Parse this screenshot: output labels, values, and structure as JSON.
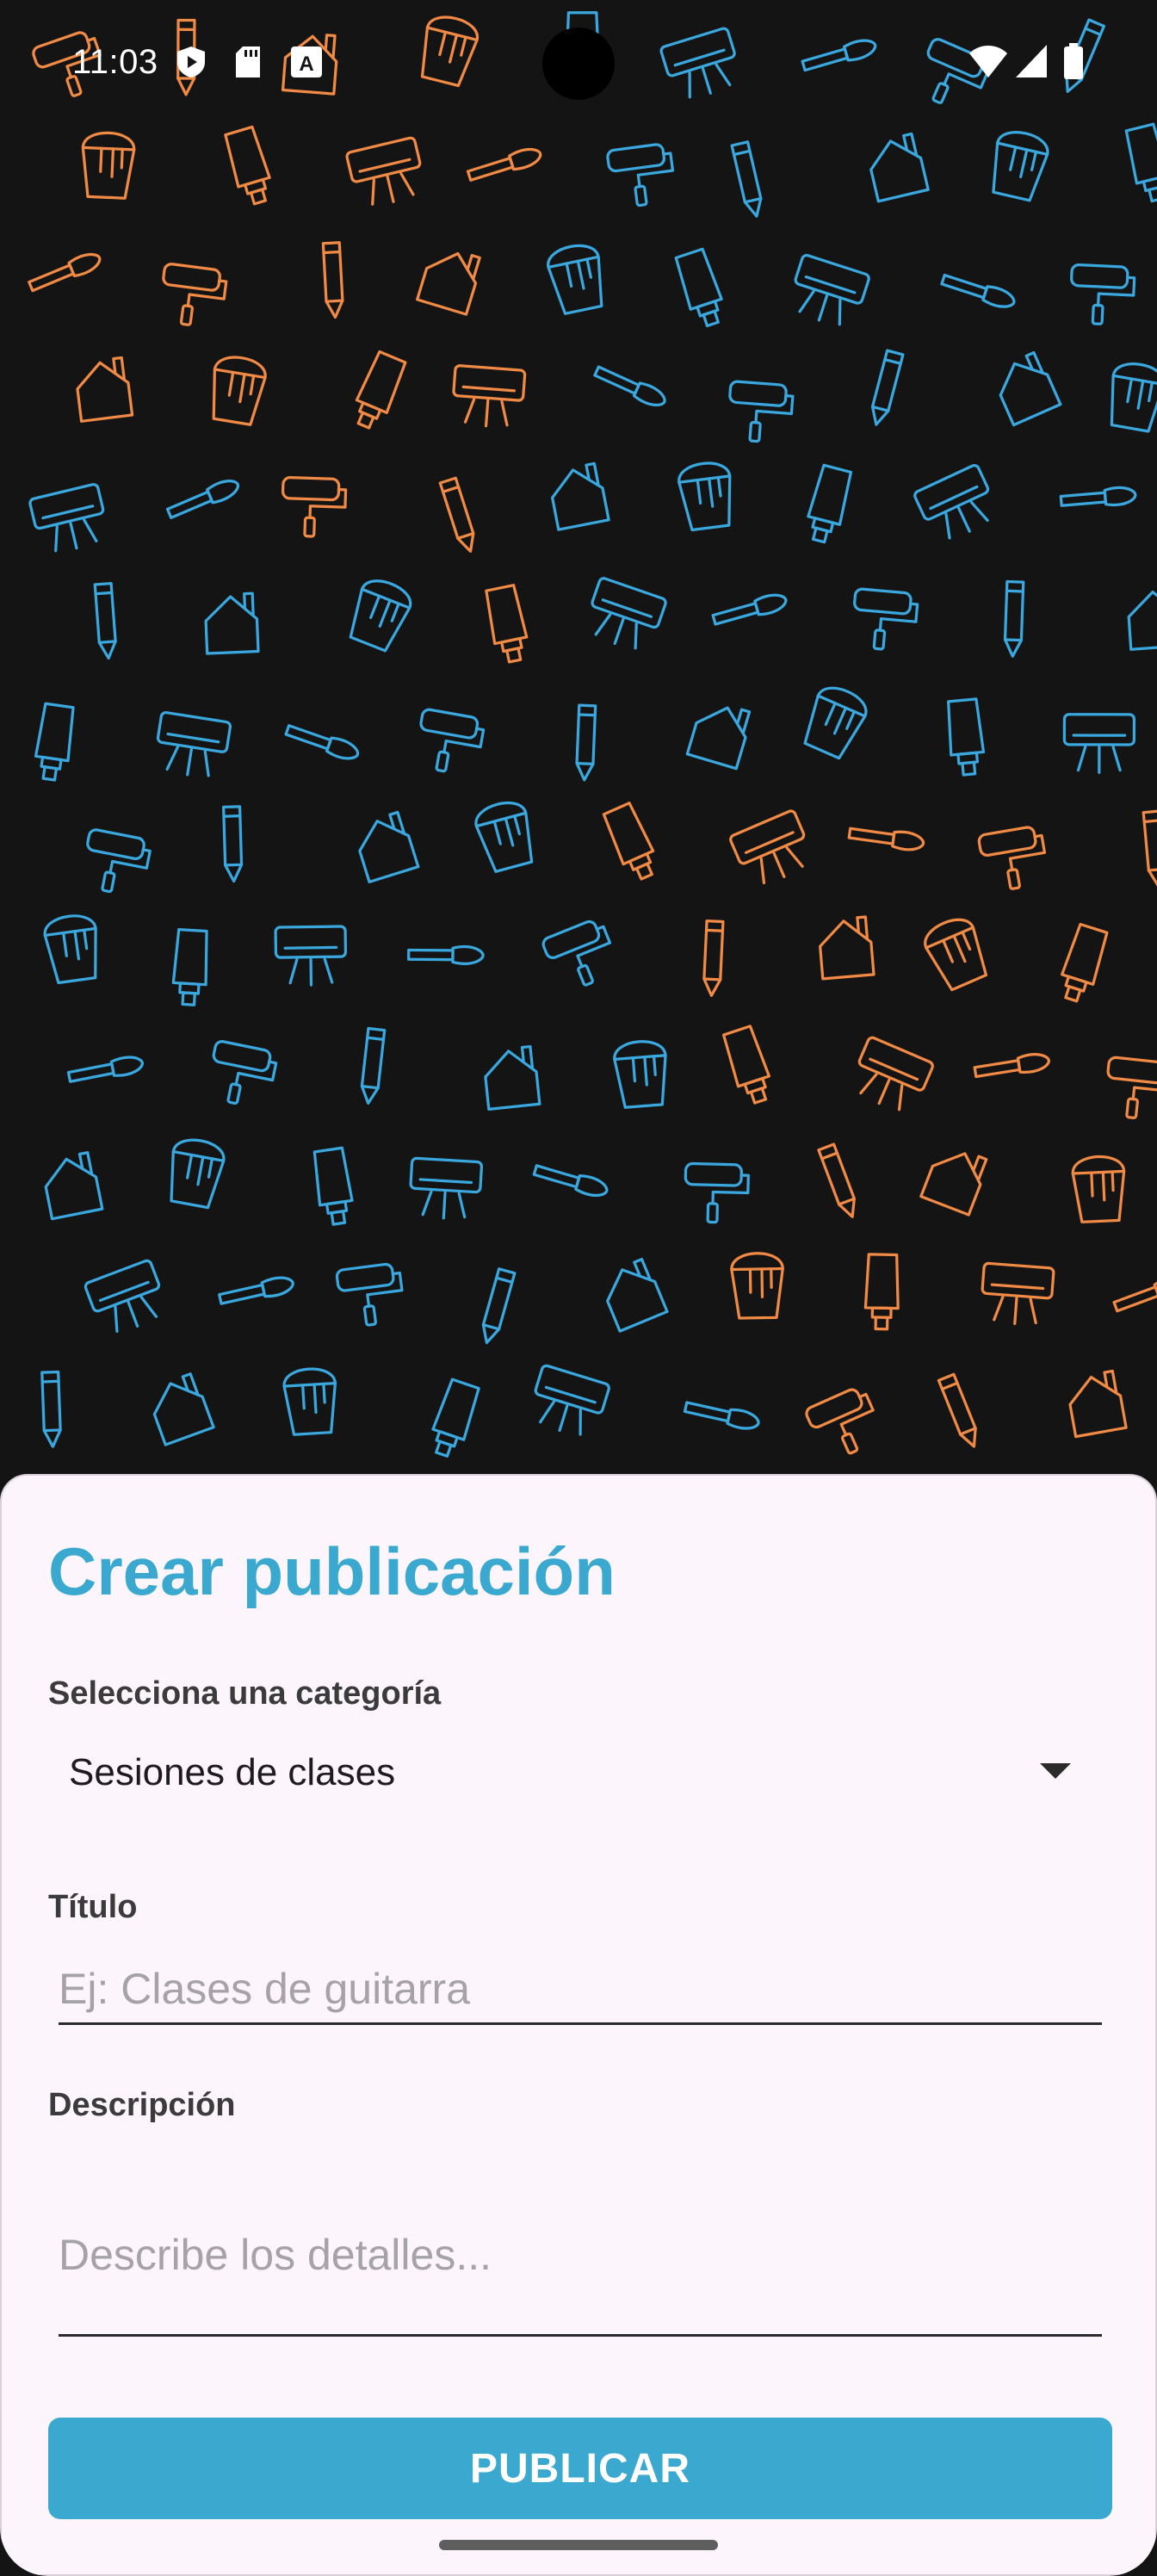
{
  "status_bar": {
    "time": "11:03",
    "left_icons": [
      "play-protect-icon",
      "sd-card-icon",
      "keyboard-a-icon"
    ],
    "right_icons": [
      "wifi-icon",
      "signal-icon",
      "battery-icon"
    ]
  },
  "background": {
    "pattern_icons": [
      "paint-roller",
      "pencil",
      "house",
      "paint-bucket",
      "paint-tube",
      "air-conditioner",
      "paint-brush"
    ],
    "colors": {
      "orange": "#f08a45",
      "blue": "#3aa8df",
      "base": "#141414"
    }
  },
  "sheet": {
    "title": "Crear publicación",
    "category": {
      "label": "Selecciona una categoría",
      "selected": "Sesiones de clases"
    },
    "title_field": {
      "label": "Título",
      "placeholder": "Ej: Clases de guitarra"
    },
    "description_field": {
      "label": "Descripción",
      "placeholder": "Describe los detalles..."
    },
    "publish_label": "PUBLICAR"
  },
  "colors": {
    "accent": "#3aa8cf",
    "sheet_bg": "#fcf6fc"
  }
}
